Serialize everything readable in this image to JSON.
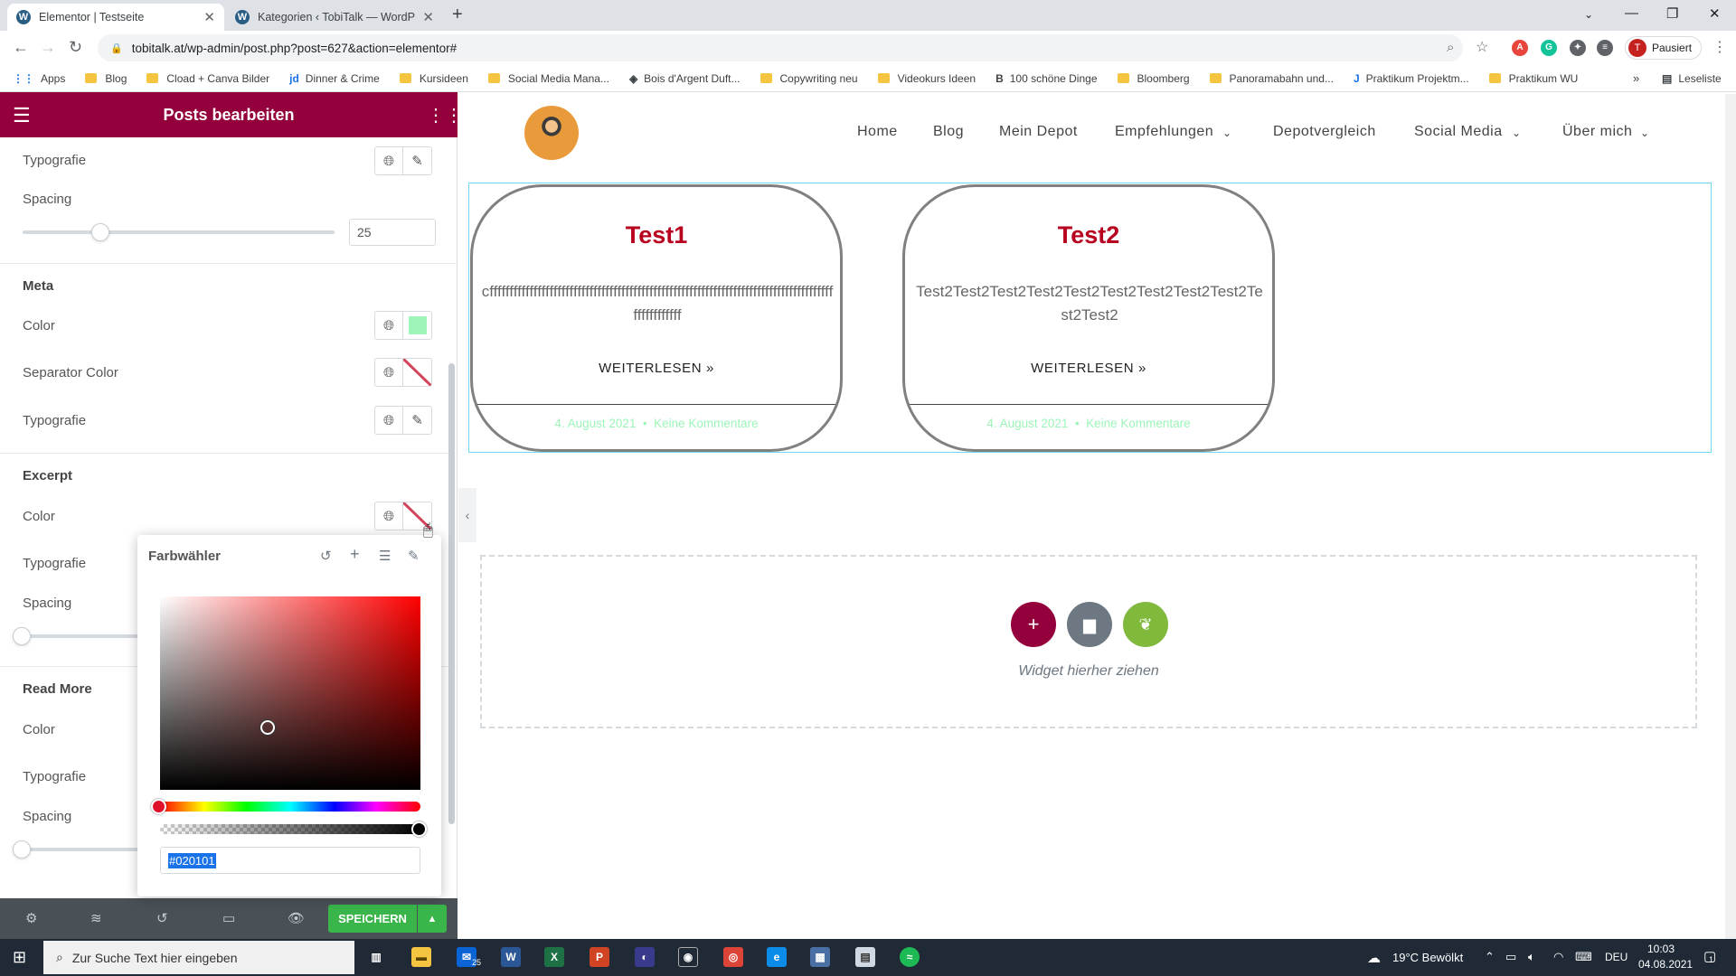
{
  "browser": {
    "tabs": [
      {
        "title": "Elementor | Testseite"
      },
      {
        "title": "Kategorien ‹ TobiTalk — WordPre"
      }
    ],
    "url": "tobitalk.at/wp-admin/post.php?post=627&action=elementor#",
    "profile_label": "Pausiert",
    "profile_initial": "T",
    "bookmarks": [
      {
        "label": "Apps"
      },
      {
        "label": "Blog"
      },
      {
        "label": "Cload + Canva Bilder"
      },
      {
        "label": "Dinner & Crime"
      },
      {
        "label": "Kursideen"
      },
      {
        "label": "Social Media Mana..."
      },
      {
        "label": "Bois d'Argent Duft..."
      },
      {
        "label": "Copywriting neu"
      },
      {
        "label": "Videokurs Ideen"
      },
      {
        "label": "100 schöne Dinge"
      },
      {
        "label": "Bloomberg"
      },
      {
        "label": "Panoramabahn und..."
      },
      {
        "label": "Praktikum Projektm..."
      },
      {
        "label": "Praktikum WU"
      }
    ],
    "reading_list": "Leseliste"
  },
  "panel": {
    "title": "Posts bearbeiten",
    "typografie": "Typografie",
    "spacing": "Spacing",
    "spacing_value": "25",
    "spacing_level": 0.25,
    "meta": {
      "title": "Meta",
      "color": "Color",
      "color_value": "#9df5b9",
      "separator_color": "Separator Color",
      "typografie": "Typografie"
    },
    "excerpt": {
      "title": "Excerpt",
      "color": "Color",
      "typografie": "Typografie",
      "spacing": "Spacing"
    },
    "read_more": {
      "title": "Read More",
      "color": "Color",
      "typografie": "Typografie",
      "spacing": "Spacing"
    },
    "save_label": "SPEICHERN"
  },
  "color_picker": {
    "title": "Farbwähler",
    "hex_value": "#020101",
    "hue_level": 0.0,
    "alpha_level": 1.0
  },
  "site": {
    "nav": [
      {
        "label": "Home"
      },
      {
        "label": "Blog"
      },
      {
        "label": "Mein Depot"
      },
      {
        "label": "Empfehlungen"
      },
      {
        "label": "Depotvergleich"
      },
      {
        "label": "Social Media"
      },
      {
        "label": "Über mich"
      }
    ],
    "posts": [
      {
        "title": "Test1",
        "excerpt": "cffffffffffffffffffffffffffffffffffffffffffffffffffffffffffffffffffffffffffffffffffffffffffffffffff",
        "read_more": "WEITERLESEN »",
        "date": "4. August 2021",
        "comments": "Keine Kommentare"
      },
      {
        "title": "Test2",
        "excerpt": "Test2Test2Test2Test2Test2Test2Test2Test2Test2Test2Test2",
        "read_more": "WEITERLESEN »",
        "date": "4. August 2021",
        "comments": "Keine Kommentare"
      }
    ],
    "dropzone_label": "Widget hierher ziehen",
    "accent": "#93003c",
    "post_title_color": "#b8001f"
  },
  "taskbar": {
    "search_placeholder": "Zur Suche Text hier eingeben",
    "mail_badge": "25",
    "weather": "19°C  Bewölkt",
    "lang": "DEU",
    "time": "10:03",
    "date": "04.08.2021",
    "notifications": "1"
  }
}
